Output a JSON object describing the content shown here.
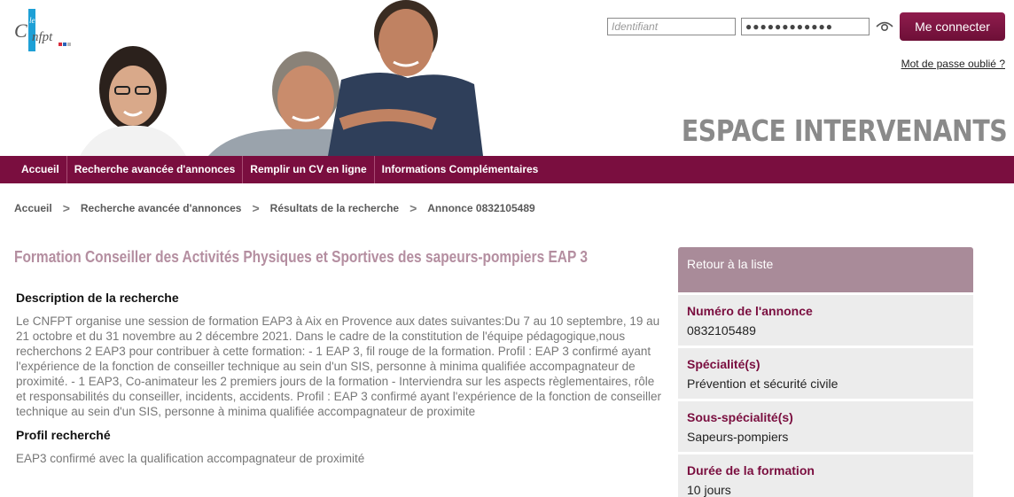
{
  "header": {
    "logo_text": "CNFPT",
    "login": {
      "identifiant_placeholder": "Identifiant",
      "password_value": "●●●●●●●●●●●●",
      "connect_label": "Me connecter",
      "forgot_label": "Mot de passe oublié ?"
    },
    "espace_title": "ESPACE INTERVENANTS"
  },
  "nav": {
    "items": [
      {
        "label": "Accueil"
      },
      {
        "label": "Recherche avancée d'annonces"
      },
      {
        "label": "Remplir un CV en ligne"
      },
      {
        "label": "Informations Complémentaires"
      }
    ]
  },
  "breadcrumb": {
    "items": [
      {
        "label": "Accueil"
      },
      {
        "label": "Recherche avancée d'annonces"
      },
      {
        "label": "Résultats de la recherche"
      },
      {
        "label": "Annonce 0832105489"
      }
    ],
    "separator": ">"
  },
  "main": {
    "title": "Formation Conseiller des Activités Physiques et Sportives des sapeurs-pompiers EAP 3",
    "description_heading": "Description de la recherche",
    "description_text": "Le CNFPT organise une session de formation EAP3 à Aix en Provence aux dates suivantes:Du 7 au 10 septembre, 19 au 21 octobre et du 31 novembre au 2 décembre 2021. Dans le cadre de la constitution de l'équipe pédagogique,nous recherchons 2 EAP3 pour contribuer à cette formation: - 1 EAP 3, fil rouge de la formation. Profil : EAP 3 confirmé ayant l'expérience de la fonction de conseiller technique au sein d'un SIS, personne à minima qualifiée accompagnateur de proximité. - 1 EAP3, Co-animateur les 2 premiers jours de la formation - Interviendra sur les aspects règlementaires, rôle et responsabilités du conseiller, incidents, accidents. Profil : EAP 3 confirmé ayant l'expérience de la fonction de conseiller technique au sein d'un SIS, personne à minima qualifiée accompagnateur de proximite",
    "profile_heading": "Profil recherché",
    "profile_text": "EAP3 confirmé avec la qualification accompagnateur de proximité"
  },
  "sidebar": {
    "back_label": "Retour à la liste",
    "fields": [
      {
        "label": "Numéro de l'annonce",
        "value": "0832105489"
      },
      {
        "label": "Spécialité(s)",
        "value": "Prévention et sécurité civile"
      },
      {
        "label": "Sous-spécialité(s)",
        "value": "Sapeurs-pompiers"
      },
      {
        "label": "Durée de la formation",
        "value": "10 jours"
      }
    ]
  },
  "colors": {
    "brand": "#7a0e3f",
    "title_pink": "#b48ea0",
    "sidebar_header": "#a98b99",
    "sidebar_bg": "#ececec"
  }
}
